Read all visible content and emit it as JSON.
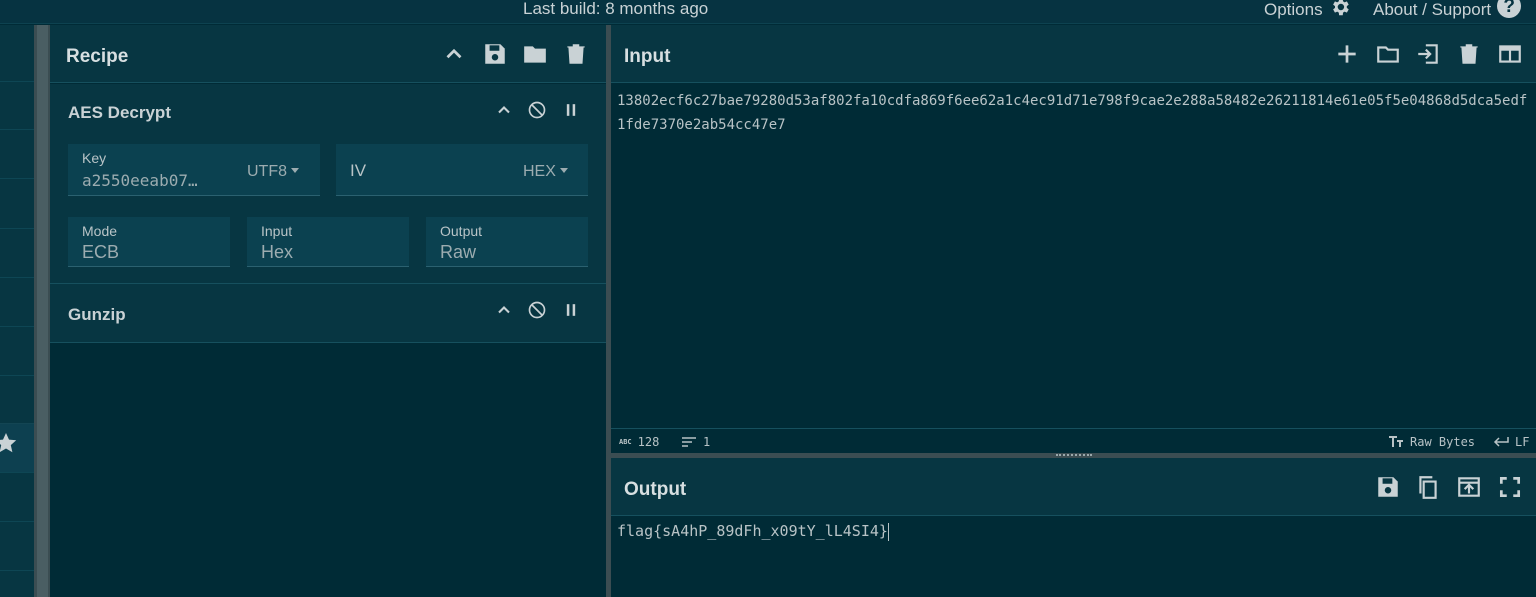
{
  "topbar": {
    "build": "Last build: 8 months ago",
    "options": "Options",
    "about": "About / Support",
    "question": "?"
  },
  "recipe": {
    "title": "Recipe",
    "operations": [
      {
        "name": "AES Decrypt",
        "key_label": "Key",
        "key_value": "a2550eeab07…",
        "key_encoding": "UTF8",
        "iv_label": "IV",
        "iv_encoding": "HEX",
        "mode_label": "Mode",
        "mode_value": "ECB",
        "input_label": "Input",
        "input_value": "Hex",
        "output_label": "Output",
        "output_value": "Raw"
      },
      {
        "name": "Gunzip"
      }
    ]
  },
  "input": {
    "title": "Input",
    "text": "13802ecf6c27bae79280d53af802fa10cdfa869f6ee62a1c4ec91d71e798f9cae2e288a58482e26211814e61e05f5e04868d5dca5edf1fde7370e2ab54cc47e7",
    "status": {
      "length_icon": "ABC",
      "length": "128",
      "lines": "1",
      "encoding": "Raw Bytes",
      "eol": "LF"
    }
  },
  "output": {
    "title": "Output",
    "text": "flag{sA4hP_89dFh_x09tY_lL4SI4}"
  },
  "colors": {
    "background": "#002b36",
    "panel": "#073642",
    "text": "#c7d0d3"
  }
}
